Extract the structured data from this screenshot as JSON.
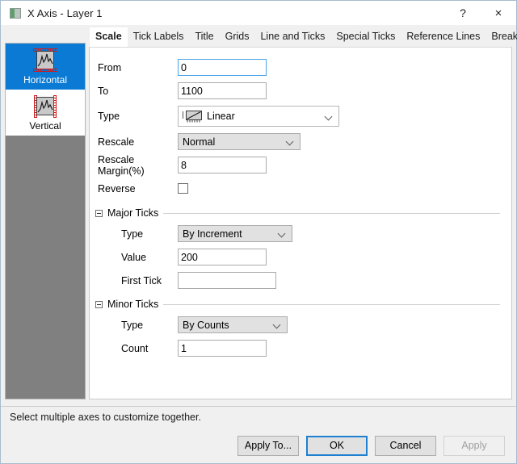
{
  "window": {
    "title": "X Axis - Layer 1",
    "icon": "axis-dialog-icon",
    "help_label": "?",
    "close_label": "×"
  },
  "sidebar": {
    "items": [
      {
        "label": "Horizontal",
        "icon": "horizontal-axis-icon",
        "selected": true
      },
      {
        "label": "Vertical",
        "icon": "vertical-axis-icon",
        "selected": false
      }
    ]
  },
  "tabs": [
    {
      "label": "Scale",
      "active": true
    },
    {
      "label": "Tick Labels",
      "active": false
    },
    {
      "label": "Title",
      "active": false
    },
    {
      "label": "Grids",
      "active": false
    },
    {
      "label": "Line and Ticks",
      "active": false
    },
    {
      "label": "Special Ticks",
      "active": false
    },
    {
      "label": "Reference Lines",
      "active": false
    },
    {
      "label": "Breaks",
      "active": false
    }
  ],
  "scale": {
    "from": {
      "label": "From",
      "value": "0",
      "placeholder": ""
    },
    "to": {
      "label": "To",
      "value": "1100",
      "placeholder": ""
    },
    "type": {
      "label": "Type",
      "value": "Linear",
      "icon": "linear-scale-icon"
    },
    "rescale": {
      "label": "Rescale",
      "value": "Normal"
    },
    "rescale_margin": {
      "label": "Rescale Margin(%)",
      "value": "8",
      "placeholder": ""
    },
    "reverse": {
      "label": "Reverse",
      "checked": false
    }
  },
  "major_ticks": {
    "title": "Major Ticks",
    "type": {
      "label": "Type",
      "value": "By Increment"
    },
    "value": {
      "label": "Value",
      "value": "200",
      "placeholder": ""
    },
    "first_tick": {
      "label": "First Tick",
      "value": "",
      "placeholder": ""
    }
  },
  "minor_ticks": {
    "title": "Minor Ticks",
    "type": {
      "label": "Type",
      "value": "By Counts"
    },
    "count": {
      "label": "Count",
      "value": "1",
      "placeholder": ""
    }
  },
  "status": {
    "message": "Select multiple axes to customize together."
  },
  "buttons": {
    "apply_to": {
      "label": "Apply To...",
      "enabled": true
    },
    "ok": {
      "label": "OK",
      "enabled": true,
      "default": true
    },
    "cancel": {
      "label": "Cancel",
      "enabled": true
    },
    "apply": {
      "label": "Apply",
      "enabled": false
    }
  },
  "colors": {
    "selection_blue": "#0a7ad4",
    "default_button_border": "#1f7fd0",
    "sidebar_filler": "#808080",
    "tick_red": "#d11a1a"
  }
}
